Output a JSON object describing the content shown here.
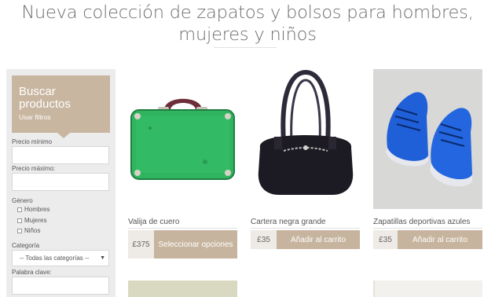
{
  "page": {
    "headline": "Nueva colección de zapatos y bolsos para hombres, mujeres y niños"
  },
  "sidebar": {
    "title": "Buscar productos",
    "subtitle": "Usar filtros",
    "min_price_label": "Precio mínimo",
    "max_price_label": "Precio máximo:",
    "gender_label": "Género",
    "genders": [
      "Hombres",
      "Mujeres",
      "Niños"
    ],
    "category_label": "Categoría",
    "category_selected": "-- Todas las categorías --",
    "keyword_label": "Palabra clave:"
  },
  "products": [
    {
      "name": "Valija de cuero",
      "price": "£375",
      "action": "Seleccionar opciones",
      "image": "green-suitcase"
    },
    {
      "name": "Cartera negra grande",
      "price": "£35",
      "action": "Añadir al carrito",
      "image": "black-handbag"
    },
    {
      "name": "Zapatillas deportivas azules",
      "price": "£35",
      "action": "Añadir al carrito",
      "image": "blue-sneakers"
    }
  ],
  "colors": {
    "accent": "#c6b49e",
    "sidebar_bg": "#ececec",
    "price_bg": "#eeeae5"
  }
}
